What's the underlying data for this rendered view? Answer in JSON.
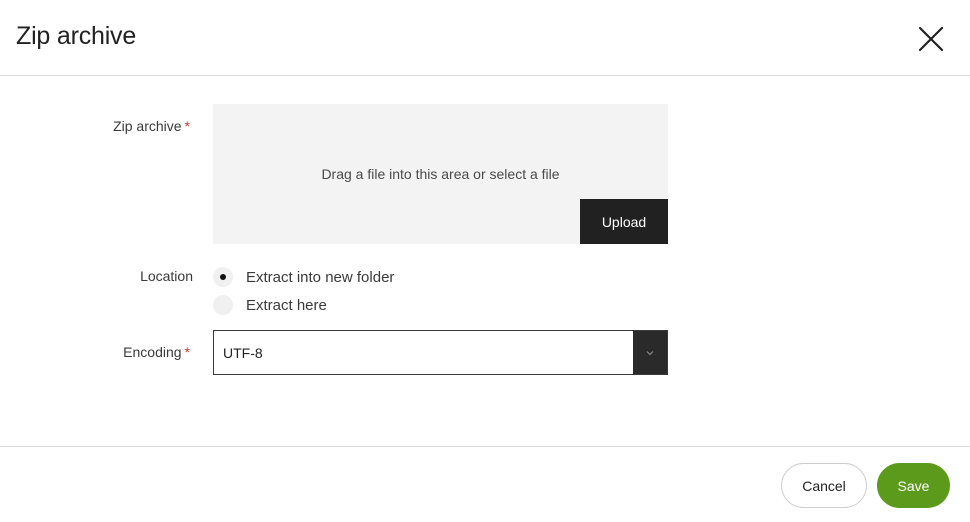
{
  "dialog": {
    "title": "Zip archive",
    "close_icon": "close-icon"
  },
  "form": {
    "zip_archive": {
      "label": "Zip archive",
      "required_mark": "*",
      "drop_text": "Drag a file into this area or select a file",
      "upload_label": "Upload"
    },
    "location": {
      "label": "Location",
      "options": [
        {
          "label": "Extract into new folder",
          "checked": true
        },
        {
          "label": "Extract here",
          "checked": false
        }
      ]
    },
    "encoding": {
      "label": "Encoding",
      "required_mark": "*",
      "selected": "UTF-8",
      "arrow_icon": "chevron-down-icon"
    }
  },
  "footer": {
    "cancel_label": "Cancel",
    "save_label": "Save"
  },
  "colors": {
    "save": "#5c9a1b",
    "upload": "#212121",
    "required": "#d9342b"
  }
}
